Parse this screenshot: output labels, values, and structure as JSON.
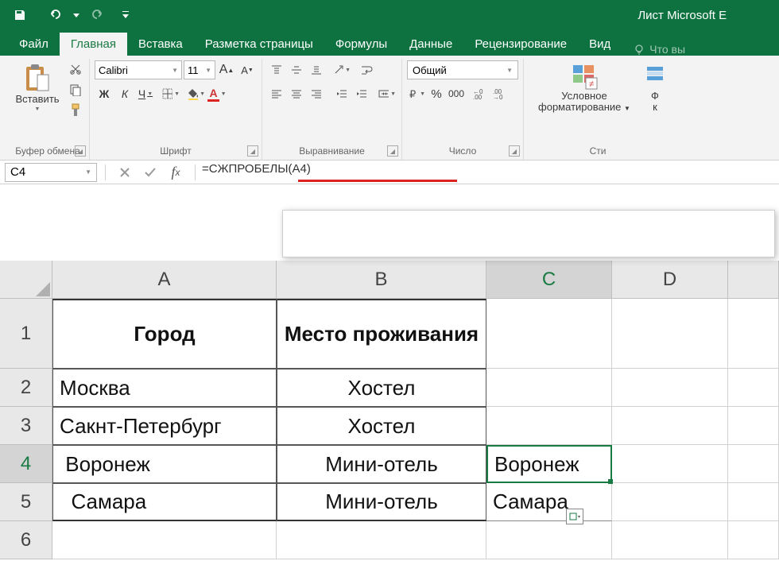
{
  "titlebar": {
    "title": "Лист Microsoft E"
  },
  "tabs": {
    "file": "Файл",
    "home": "Главная",
    "insert": "Вставка",
    "page_layout": "Разметка страницы",
    "formulas": "Формулы",
    "data": "Данные",
    "review": "Рецензирование",
    "view": "Вид",
    "tell_me": "Что вы"
  },
  "ribbon": {
    "clipboard": {
      "label": "Буфер обмена",
      "paste": "Вставить"
    },
    "font": {
      "label": "Шрифт",
      "name": "Calibri",
      "size": "11",
      "bold": "Ж",
      "italic": "К",
      "underline": "Ч"
    },
    "alignment": {
      "label": "Выравнивание"
    },
    "number": {
      "label": "Число",
      "format": "Общий"
    },
    "styles": {
      "label": "Сти",
      "cond_fmt_1": "Условное",
      "cond_fmt_2": "форматирование",
      "fmt_partial": "Ф",
      "fmt_partial2": "к"
    }
  },
  "name_box": "C4",
  "formula": "=СЖПРОБЕЛЫ(A4)",
  "columns": [
    "A",
    "B",
    "C",
    "D"
  ],
  "rows": [
    "1",
    "2",
    "3",
    "4",
    "5",
    "6"
  ],
  "cells": {
    "A1": "Город",
    "B1": "Место проживания",
    "A2": "Москва",
    "B2": "Хостел",
    "A3": "Сакнт-Петербург",
    "B3": "Хостел",
    "A4": " Воронеж",
    "B4": "Мини-отель",
    "C4": "Воронеж",
    "A5": "  Самара",
    "B5": "Мини-отель",
    "C5": "Самара"
  }
}
